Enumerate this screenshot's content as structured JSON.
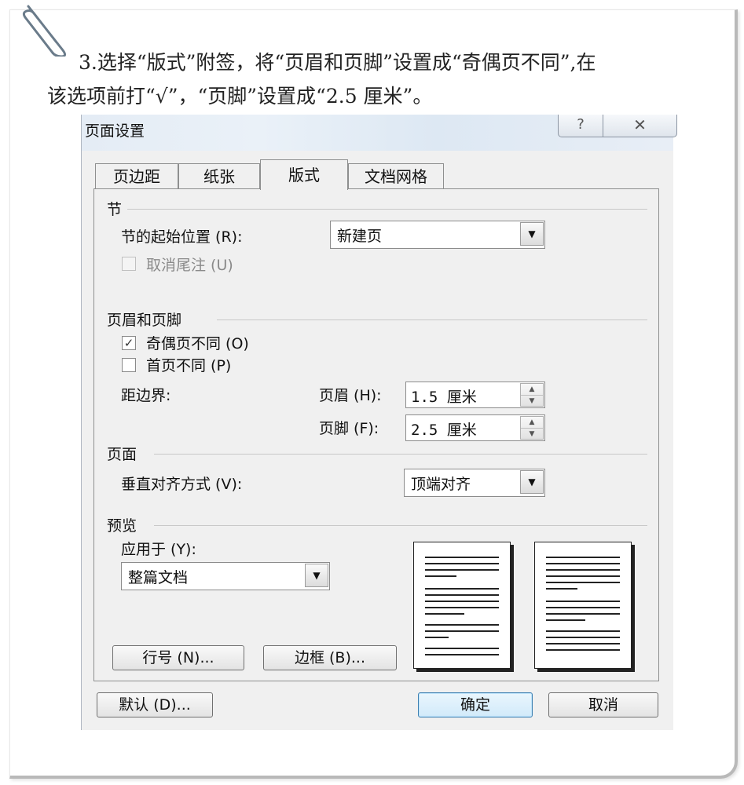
{
  "instruction": {
    "line1": "3.选择“版式”附签，将“页眉和页脚”设置成“奇偶页不同”,在",
    "line2": "该选项前打“√”，“页脚”设置成“2.5 厘米”。"
  },
  "dialog": {
    "title": "页面设置",
    "help_glyph": "?",
    "close_glyph": "✕",
    "tabs": [
      {
        "label": "页边距",
        "active": false
      },
      {
        "label": "纸张",
        "active": false
      },
      {
        "label": "版式",
        "active": true
      },
      {
        "label": "文档网格",
        "active": false
      }
    ],
    "section_jie": {
      "heading": "节",
      "start_label": "节的起始位置 (R):",
      "start_value": "新建页",
      "suppress_endnotes_label": "取消尾注 (U)",
      "suppress_endnotes_checked": false,
      "suppress_endnotes_enabled": false
    },
    "section_header_footer": {
      "heading": "页眉和页脚",
      "odd_even_label": "奇偶页不同 (O)",
      "odd_even_checked": true,
      "first_page_label": "首页不同 (P)",
      "first_page_checked": false,
      "from_edge_label": "距边界:",
      "header_label": "页眉 (H):",
      "header_value": "1.5 厘米",
      "footer_label": "页脚 (F):",
      "footer_value": "2.5 厘米"
    },
    "section_page": {
      "heading": "页面",
      "valign_label": "垂直对齐方式 (V):",
      "valign_value": "顶端对齐"
    },
    "section_preview": {
      "heading": "预览",
      "apply_to_label": "应用于 (Y):",
      "apply_to_value": "整篇文档",
      "line_numbers_button": "行号 (N)...",
      "borders_button": "边框 (B)..."
    },
    "buttons": {
      "default": "默认 (D)...",
      "ok": "确定",
      "cancel": "取消"
    },
    "checkmark_glyph": "✓",
    "dropdown_glyph": "▼",
    "spin_up_glyph": "▲",
    "spin_down_glyph": "▼"
  },
  "icons": [
    "paperclip-icon",
    "help-icon",
    "close-icon",
    "chevron-down-icon",
    "spin-up-icon",
    "spin-down-icon"
  ]
}
